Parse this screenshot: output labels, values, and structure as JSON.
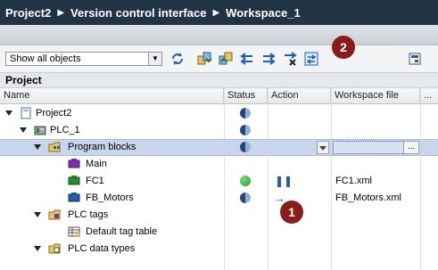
{
  "breadcrumb": {
    "items": [
      "Project2",
      "Version control interface",
      "Workspace_1"
    ],
    "separator": "▶"
  },
  "toolbar": {
    "filter_value": "Show all objects",
    "icons": [
      "refresh-icon",
      "import-icon",
      "export-icon",
      "sync-left-icon",
      "sync-right-icon",
      "discard-icon",
      "compare-icon",
      "settings-icon"
    ]
  },
  "annotations": {
    "badge_1": "1",
    "badge_2": "2"
  },
  "section": {
    "title": "Project"
  },
  "columns": {
    "name": "Name",
    "status": "Status",
    "action": "Action",
    "workspace_file": "Workspace file",
    "more": "..."
  },
  "tree": {
    "rows": [
      {
        "label": "Project2",
        "status": "half-blue",
        "action": "",
        "file": ""
      },
      {
        "label": "PLC_1",
        "status": "half-blue",
        "action": "",
        "file": ""
      },
      {
        "label": "Program blocks",
        "status": "half-blue",
        "action": "",
        "file": ""
      },
      {
        "label": "Main",
        "status": "",
        "action": "",
        "file": ""
      },
      {
        "label": "FC1",
        "status": "green",
        "action": "pause",
        "file": "FC1.xml"
      },
      {
        "label": "FB_Motors",
        "status": "half-blue-dot",
        "action": "arrow-right",
        "file": "FB_Motors.xml"
      },
      {
        "label": "PLC tags",
        "status": "",
        "action": "",
        "file": ""
      },
      {
        "label": "Default tag table",
        "status": "",
        "action": "",
        "file": ""
      },
      {
        "label": "PLC data types",
        "status": "",
        "action": "",
        "file": ""
      }
    ]
  },
  "colors": {
    "titlebar": "#213443",
    "selection": "#c7d6ea",
    "badge": "#8b1a1a",
    "accent": "#1f5fae"
  }
}
